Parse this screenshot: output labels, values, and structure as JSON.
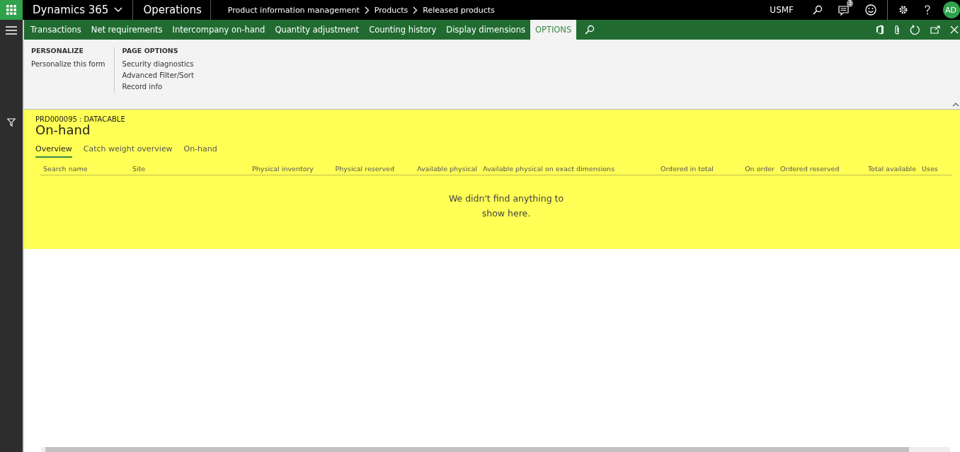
{
  "top_bar": {
    "app_name": "Dynamics 365",
    "module": "Operations",
    "breadcrumb": [
      "Product information management",
      "Products",
      "Released products"
    ],
    "company": "USMF",
    "notification_count": "3",
    "user_initials": "AD"
  },
  "action_tabs": [
    {
      "label": "Transactions",
      "selected": false
    },
    {
      "label": "Net requirements",
      "selected": false
    },
    {
      "label": "Intercompany on-hand",
      "selected": false
    },
    {
      "label": "Quantity adjustment",
      "selected": false
    },
    {
      "label": "Counting history",
      "selected": false
    },
    {
      "label": "Display dimensions",
      "selected": false
    },
    {
      "label": "OPTIONS",
      "selected": true
    }
  ],
  "options_groups": [
    {
      "title": "PERSONALIZE",
      "items": [
        "Personalize this form"
      ]
    },
    {
      "title": "PAGE OPTIONS",
      "items": [
        "Security diagnostics",
        "Advanced Filter/Sort",
        "Record info"
      ]
    }
  ],
  "record": {
    "caption": "PRD000095 : DATACABLE",
    "title": "On-hand"
  },
  "tabs": [
    {
      "label": "Overview",
      "selected": true
    },
    {
      "label": "Catch weight overview",
      "selected": false
    },
    {
      "label": "On-hand",
      "selected": false
    }
  ],
  "table": {
    "columns": [
      "Search name",
      "Site",
      "Physical inventory",
      "Physical reserved",
      "Available physical",
      "Available physical on exact dimensions",
      "Ordered in total",
      "On order",
      "Ordered reserved",
      "Total available",
      "Uses"
    ],
    "empty_message": "We didn't find anything to show here."
  }
}
